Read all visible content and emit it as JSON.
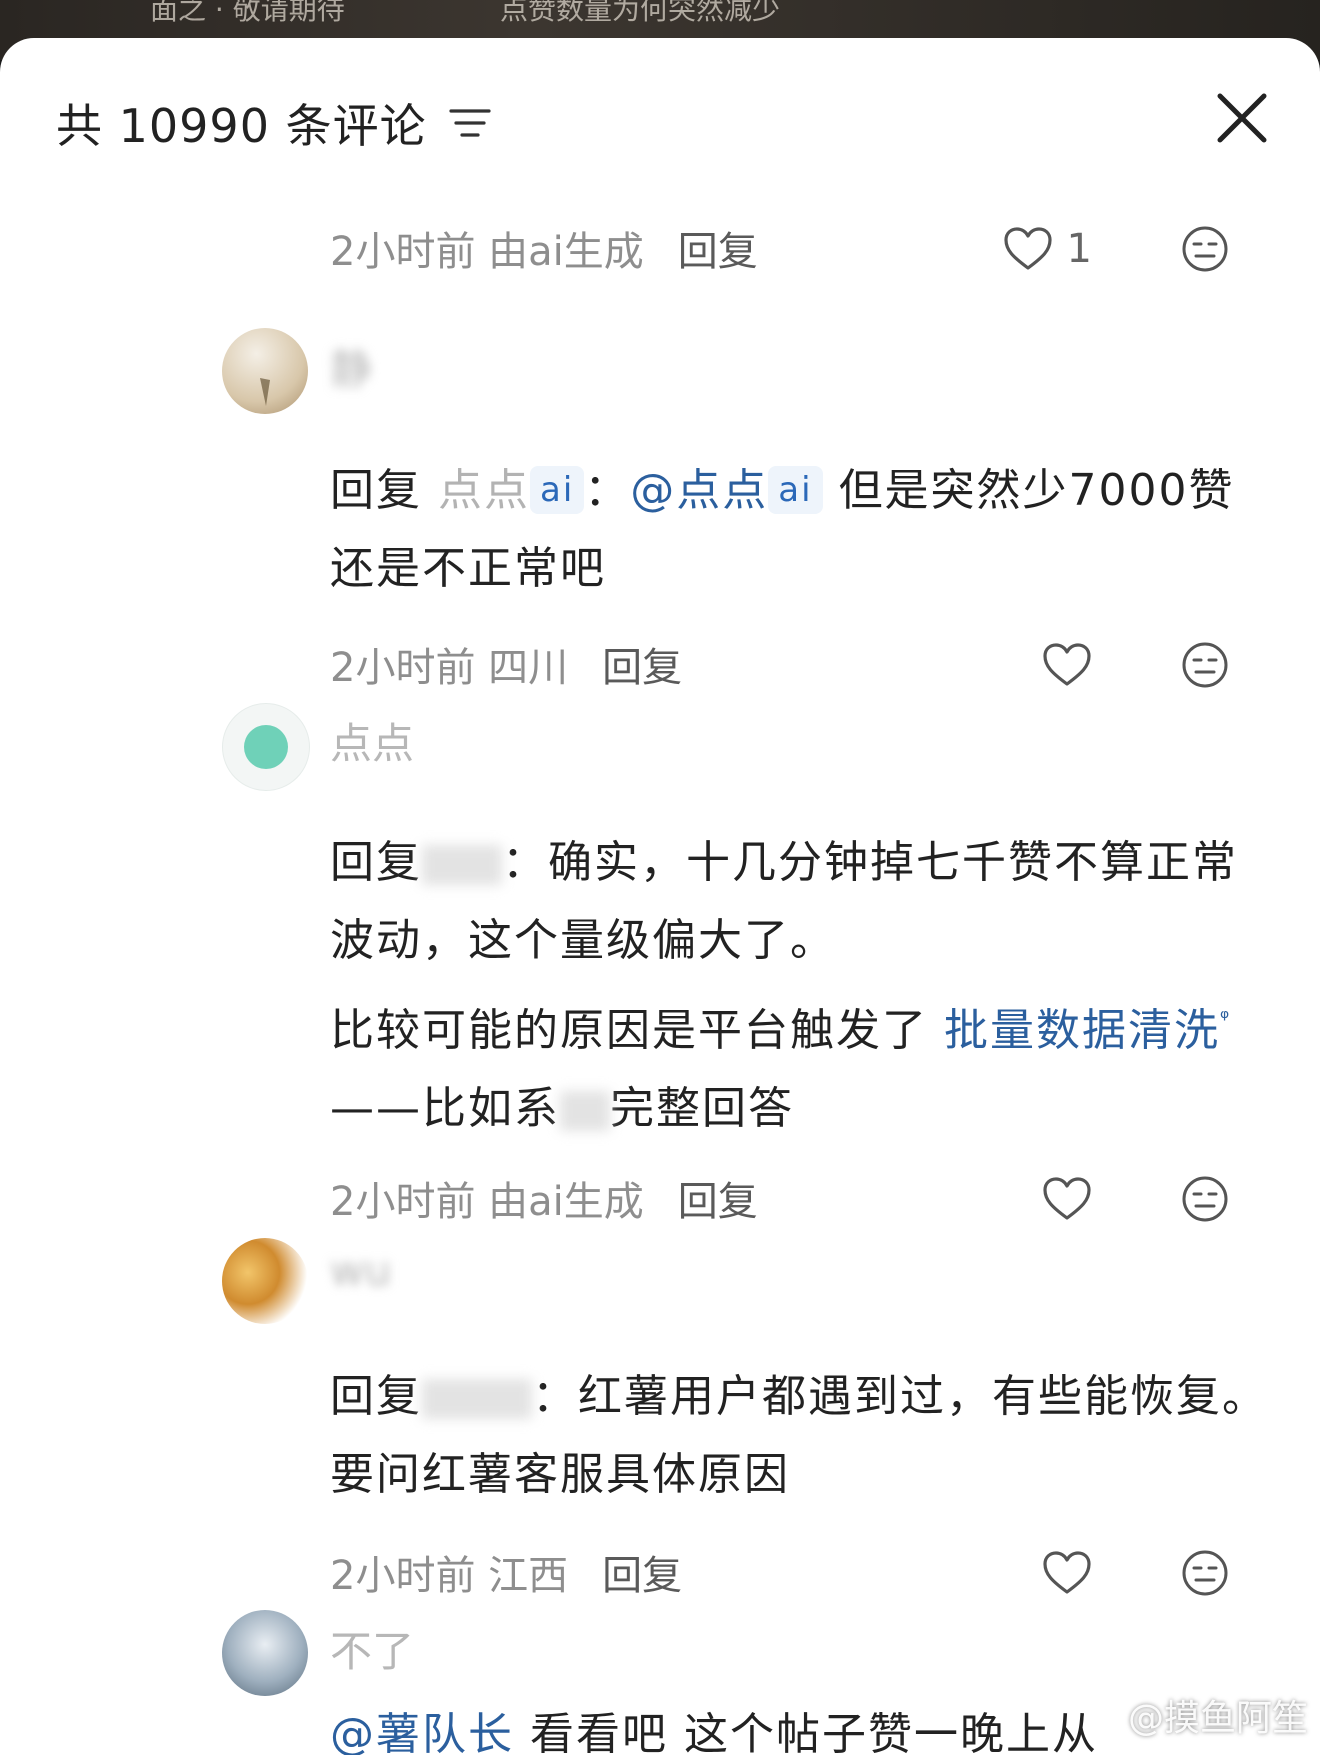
{
  "background_video": {
    "text_a": "面之 · 敬请期待",
    "text_b": "点赞数量为何突然减少"
  },
  "header": {
    "title": "共 10990 条评论",
    "filter_icon": "filter-lines-icon",
    "close_icon": "close-icon"
  },
  "comments": [
    {
      "time": "2小时前 由ai生成",
      "reply": "回复",
      "likes": "1"
    },
    {
      "username": "静",
      "reply_prefix": "回复",
      "reply_to": "点点",
      "reply_to_tag": "ai",
      "colon": "：",
      "mention": "@点点",
      "mention_tag": "ai",
      "text": "但是突然少7000赞还是不正常吧",
      "time": "2小时前 四川",
      "reply": "回复"
    },
    {
      "username": "点点",
      "reply_prefix": "回复",
      "colon": "：",
      "text_line1": "确实，十几分钟掉七千赞不算正常波动，这个量级偏大了。",
      "text_line2a": "比较可能的原因是平台触发了",
      "text_link": "批量数据清洗",
      "text_line2b": "——比如系",
      "full_answer": "完整回答",
      "time": "2小时前 由ai生成",
      "reply": "回复"
    },
    {
      "username": "wu",
      "reply_prefix": "回复",
      "colon": "：",
      "text": "红薯用户都遇到过，有些能恢复。要问红薯客服具体原因",
      "time": "2小时前 江西",
      "reply": "回复"
    },
    {
      "username": "不了",
      "mention": "@薯队长",
      "text": " 看看吧 这个帖子赞一晚上从"
    }
  ],
  "watermark": "@摸鱼阿笙",
  "colors": {
    "link": "#2b5f9e",
    "secondary_text": "#8e8e8e",
    "primary_text": "#222222"
  }
}
